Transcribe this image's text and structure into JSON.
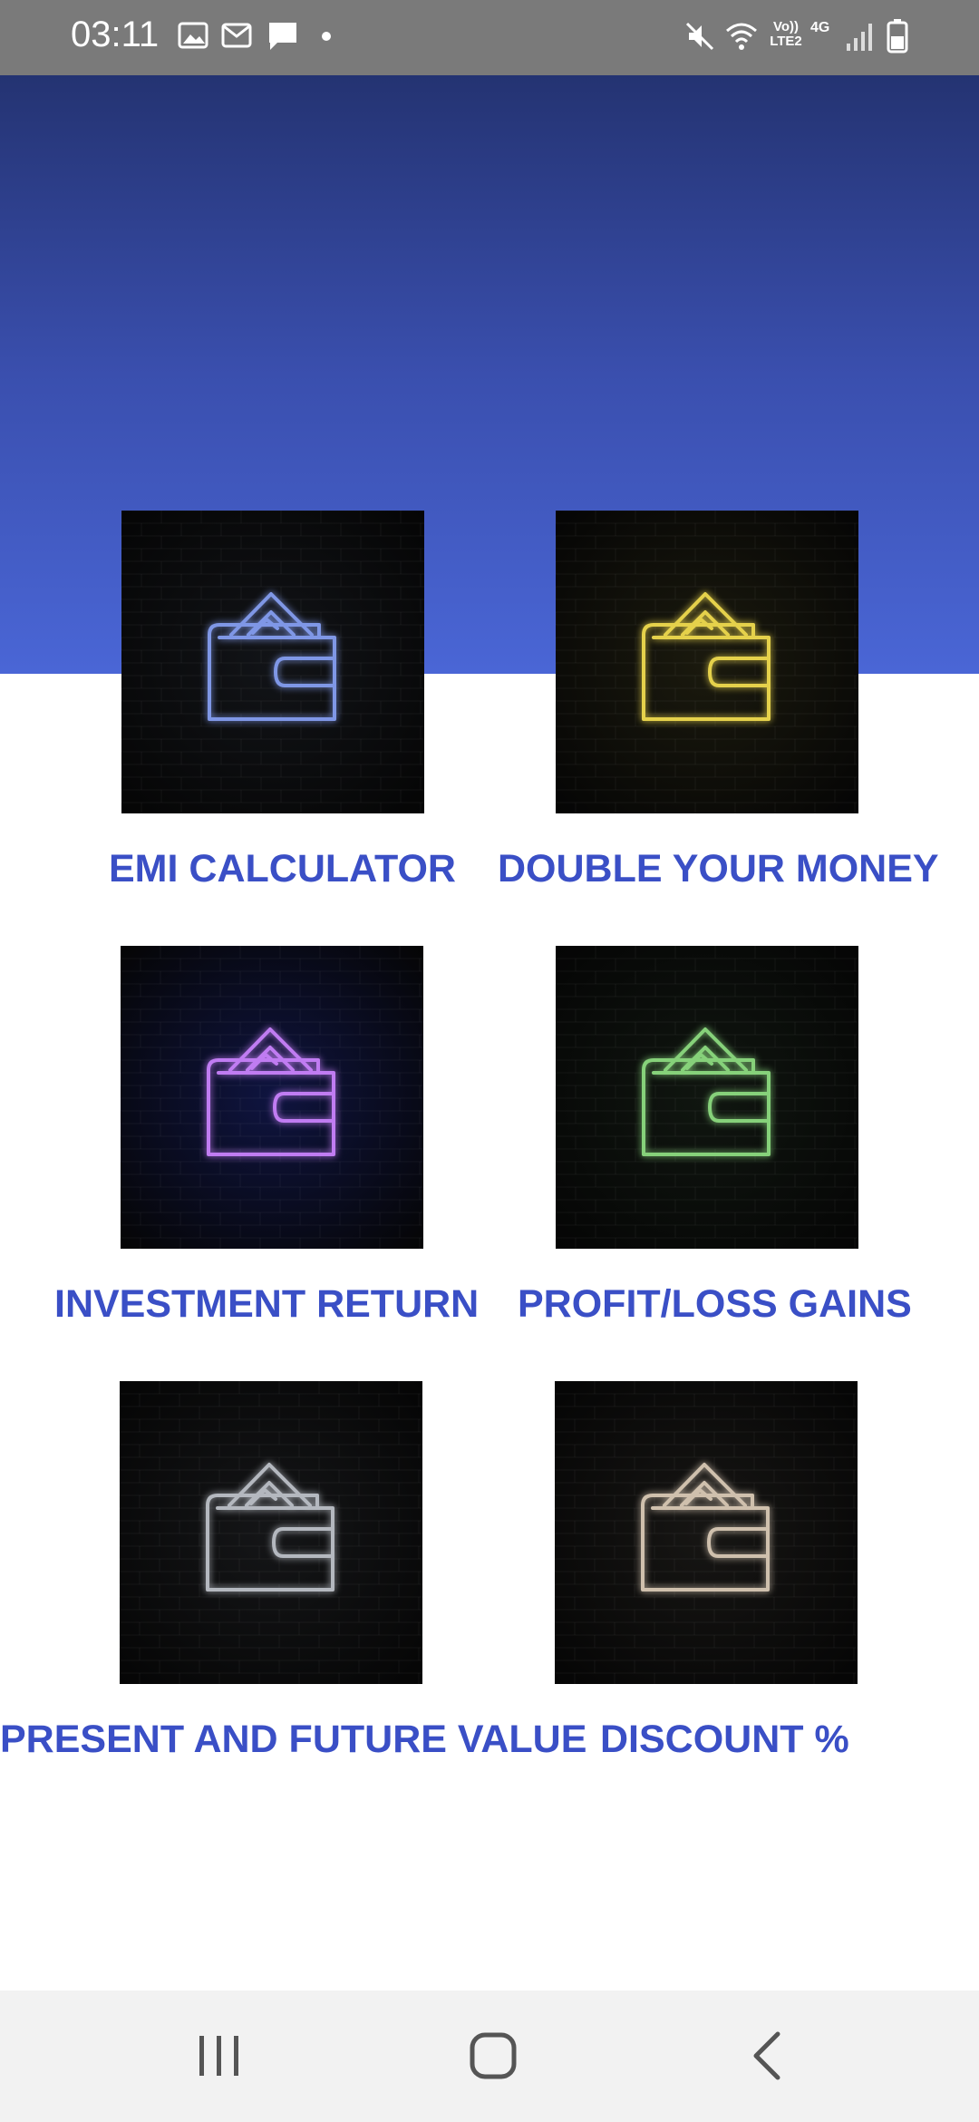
{
  "status_bar": {
    "time": "03:11",
    "left_icons": [
      "gallery-icon",
      "mail-icon",
      "chat-icon",
      "dot-icon"
    ],
    "right_icons": [
      "mute-icon",
      "wifi-icon",
      "volte-icon",
      "4g-icon",
      "signal-icon",
      "battery-icon"
    ],
    "volte_label": "Vo)) LTE2",
    "network_label": "4G"
  },
  "colors": {
    "hero_top": "#243372",
    "hero_bottom": "#4a66d6",
    "label": "#3a4fc6",
    "status_bar": "#7a7a7a"
  },
  "tiles": [
    {
      "label": "EMI CALCULATOR",
      "icon": "wallet-icon",
      "glow": "#7f97e6",
      "bg": "#121418"
    },
    {
      "label": "DOUBLE YOUR MONEY",
      "icon": "wallet-icon",
      "glow": "#e5d14b",
      "bg": "#1b1a0e"
    },
    {
      "label": "INVESTMENT RETURN",
      "icon": "wallet-icon",
      "glow": "#c07cf2",
      "bg": "#0f1440"
    },
    {
      "label": "PROFIT/LOSS GAINS",
      "icon": "wallet-icon",
      "glow": "#86d17a",
      "bg": "#101610"
    },
    {
      "label": "PRESENT AND FUTURE VALUE",
      "icon": "wallet-icon",
      "glow": "#b4b8bf",
      "bg": "#151618"
    },
    {
      "label": "DISCOUNT %",
      "icon": "wallet-icon",
      "glow": "#cfc0ad",
      "bg": "#171614"
    }
  ],
  "nav_bar": {
    "buttons": [
      "recent-apps-icon",
      "home-icon",
      "back-icon"
    ]
  }
}
